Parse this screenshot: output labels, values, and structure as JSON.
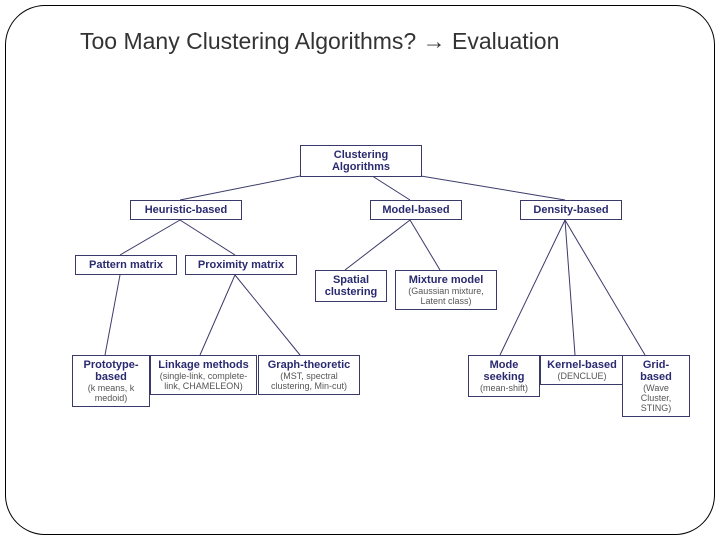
{
  "title": "Too Many Clustering Algorithms? → Evaluation",
  "root": "Clustering Algorithms",
  "l1": {
    "heuristic": "Heuristic-based",
    "model": "Model-based",
    "density": "Density-based"
  },
  "l2": {
    "pattern": "Pattern matrix",
    "proximity": "Proximity matrix",
    "spatial": "Spatial clustering",
    "mixture": {
      "t": "Mixture model",
      "s": "(Gaussian mixture, Latent class)"
    }
  },
  "l3": {
    "proto": {
      "t": "Prototype-based",
      "s": "(k means, k medoid)"
    },
    "link": {
      "t": "Linkage methods",
      "s": "(single-link, complete-link, CHAMELEON)"
    },
    "graph": {
      "t": "Graph-theoretic",
      "s": "(MST, spectral clustering, Min-cut)"
    },
    "mode": {
      "t": "Mode seeking",
      "s": "(mean-shift)"
    },
    "kernel": {
      "t": "Kernel-based",
      "s": "(DENCLUE)"
    },
    "grid": {
      "t": "Grid-based",
      "s": "(Wave Cluster, STING)"
    }
  }
}
